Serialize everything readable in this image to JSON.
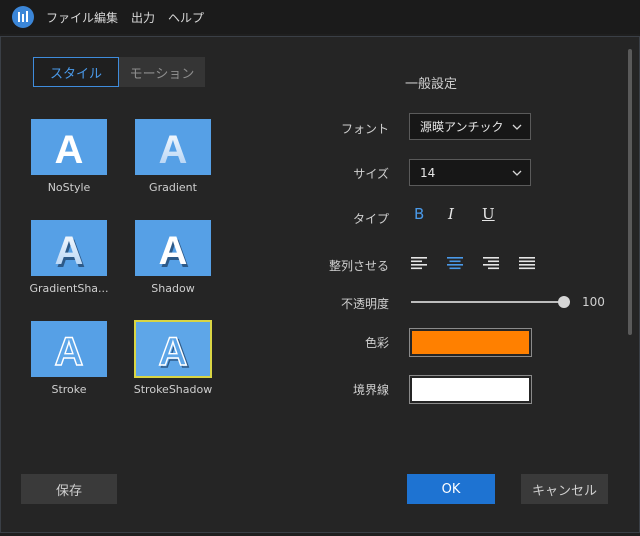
{
  "menu": {
    "items": [
      "ファイル",
      "編集",
      "出力",
      "ヘルプ"
    ]
  },
  "tabs": {
    "style": "スタイル",
    "motion": "モーション"
  },
  "styles": [
    {
      "label": "NoStyle"
    },
    {
      "label": "Gradient"
    },
    {
      "label": "GradientSha..."
    },
    {
      "label": "Shadow"
    },
    {
      "label": "Stroke"
    },
    {
      "label": "StrokeShadow",
      "selected": true
    }
  ],
  "settings": {
    "title": "一般設定",
    "font_label": "フォント",
    "font_value": "源暎アンチック",
    "size_label": "サイズ",
    "size_value": "14",
    "type_label": "タイプ",
    "bold": "B",
    "italic": "I",
    "underline": "U",
    "align_label": "整列させる",
    "opacity_label": "不透明度",
    "opacity_value": "100",
    "color_label": "色彩",
    "color_value": "#ff8000",
    "border_label": "境界線",
    "border_value": "#ffffff"
  },
  "buttons": {
    "save": "保存",
    "ok": "OK",
    "cancel": "キャンセル"
  },
  "colors": {
    "accent": "#1e73d2",
    "tab_active": "#4a9aea",
    "tile": "#56a0e6",
    "selected_outline": "#d9d544"
  }
}
